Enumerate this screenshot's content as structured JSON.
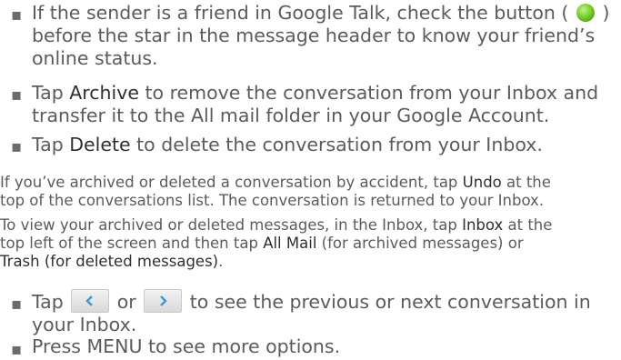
{
  "bullets": [
    {
      "part1": "If the sender is a friend in Google Talk, check the button (",
      "part2": ")",
      "line2": "before the star in the message header to know your friend’s",
      "line3": "online status."
    },
    {
      "pre": "Tap ",
      "kw": "Archive",
      "post": " to remove the conversation from your Inbox and",
      "line2": "transfer it to the All mail folder in your Google Account."
    },
    {
      "pre": "Tap ",
      "kw": "Delete",
      "post": " to delete the conversation from your Inbox."
    },
    {
      "pre": "Tap ",
      "mid": " or ",
      "post": " to see the previous or next conversation in",
      "line2": "your Inbox."
    },
    {
      "text": "Press MENU to see more options."
    }
  ],
  "para1": {
    "pre": "If you’ve archived or deleted a conversation by accident, tap ",
    "kw": "Undo",
    "post": " at the",
    "line2": "top of the conversations list. The conversation is returned to your Inbox."
  },
  "para2": {
    "pre": "To view your archived or deleted messages, in the Inbox, tap ",
    "kw1": "Inbox",
    "post": " at the",
    "line2_pre": "top left of the screen and then tap ",
    "kw2": "All Mail",
    "line2_post": " (for archived messages) or",
    "kw3": "Trash (for deleted messages)",
    "end": "."
  },
  "icons": {
    "status": "green-status-dot-icon",
    "prev": "previous-arrow-icon",
    "next": "next-arrow-icon"
  },
  "colors": {
    "body_text": "#5b5b5b",
    "keyword": "#2f2f2f",
    "status_green": "#74cf2a"
  }
}
